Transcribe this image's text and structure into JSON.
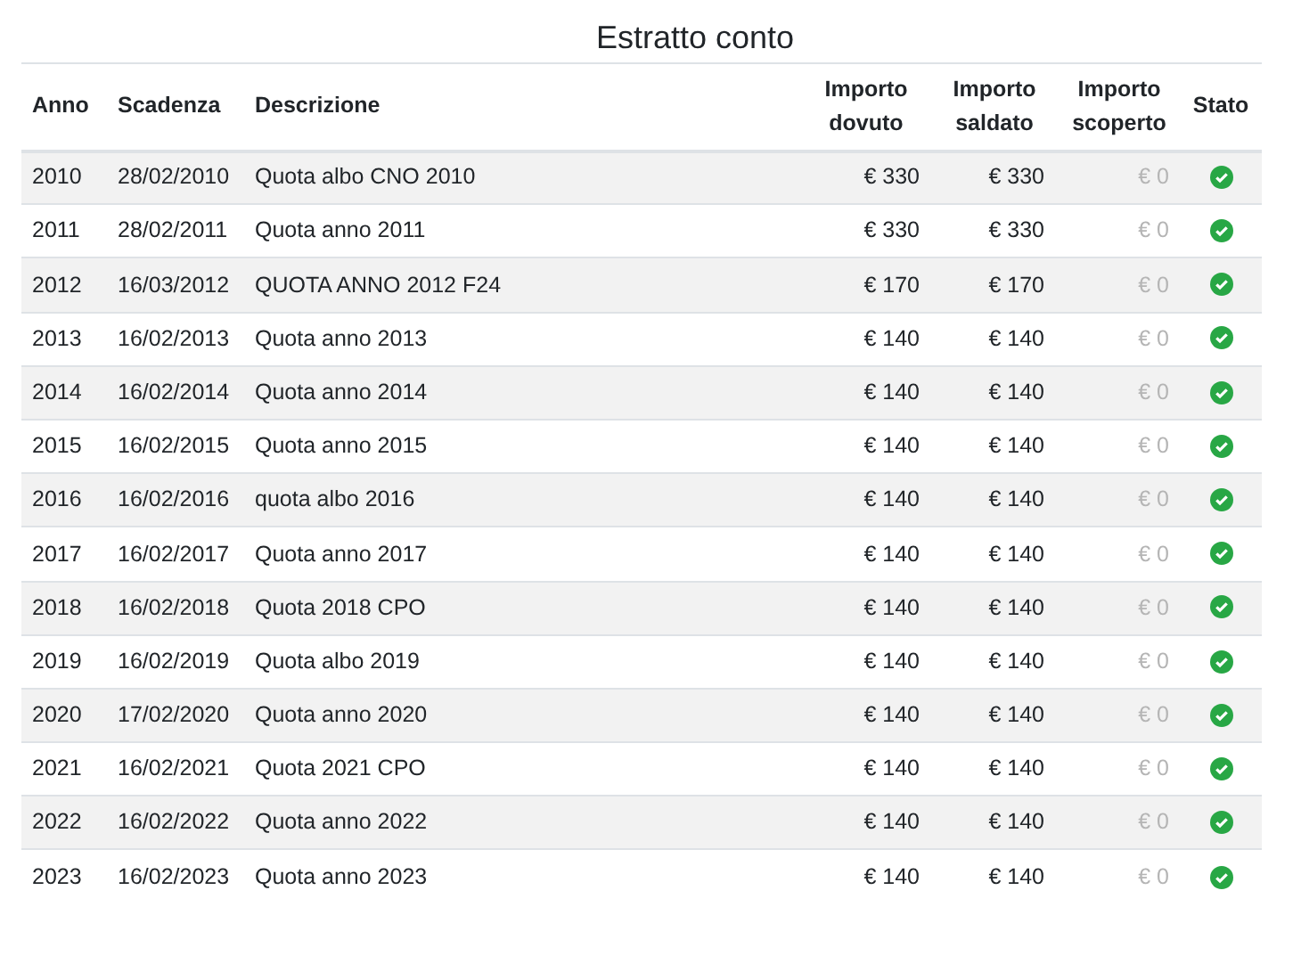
{
  "title": "Estratto conto",
  "columns": [
    "Anno",
    "Scadenza",
    "Descrizione",
    "Importo dovuto",
    "Importo saldato",
    "Importo scoperto",
    "Stato"
  ],
  "rows": [
    {
      "anno": "2010",
      "scadenza": "28/02/2010",
      "descrizione": "Quota albo CNO 2010",
      "dovuto": "€ 330",
      "saldato": "€ 330",
      "scoperto": "€ 0",
      "paid": true
    },
    {
      "anno": "2011",
      "scadenza": "28/02/2011",
      "descrizione": "Quota anno 2011",
      "dovuto": "€ 330",
      "saldato": "€ 330",
      "scoperto": "€ 0",
      "paid": true
    },
    {
      "anno": "2012",
      "scadenza": "16/03/2012",
      "descrizione": "QUOTA ANNO 2012 F24",
      "dovuto": "€ 170",
      "saldato": "€ 170",
      "scoperto": "€ 0",
      "paid": true
    },
    {
      "anno": "2013",
      "scadenza": "16/02/2013",
      "descrizione": "Quota anno 2013",
      "dovuto": "€ 140",
      "saldato": "€ 140",
      "scoperto": "€ 0",
      "paid": true
    },
    {
      "anno": "2014",
      "scadenza": "16/02/2014",
      "descrizione": "Quota anno 2014",
      "dovuto": "€ 140",
      "saldato": "€ 140",
      "scoperto": "€ 0",
      "paid": true
    },
    {
      "anno": "2015",
      "scadenza": "16/02/2015",
      "descrizione": "Quota anno 2015",
      "dovuto": "€ 140",
      "saldato": "€ 140",
      "scoperto": "€ 0",
      "paid": true
    },
    {
      "anno": "2016",
      "scadenza": "16/02/2016",
      "descrizione": "quota albo 2016",
      "dovuto": "€ 140",
      "saldato": "€ 140",
      "scoperto": "€ 0",
      "paid": true
    },
    {
      "anno": "2017",
      "scadenza": "16/02/2017",
      "descrizione": "Quota anno 2017",
      "dovuto": "€ 140",
      "saldato": "€ 140",
      "scoperto": "€ 0",
      "paid": true
    },
    {
      "anno": "2018",
      "scadenza": "16/02/2018",
      "descrizione": "Quota 2018 CPO",
      "dovuto": "€ 140",
      "saldato": "€ 140",
      "scoperto": "€ 0",
      "paid": true
    },
    {
      "anno": "2019",
      "scadenza": "16/02/2019",
      "descrizione": "Quota albo 2019",
      "dovuto": "€ 140",
      "saldato": "€ 140",
      "scoperto": "€ 0",
      "paid": true
    },
    {
      "anno": "2020",
      "scadenza": "17/02/2020",
      "descrizione": "Quota anno 2020",
      "dovuto": "€ 140",
      "saldato": "€ 140",
      "scoperto": "€ 0",
      "paid": true
    },
    {
      "anno": "2021",
      "scadenza": "16/02/2021",
      "descrizione": "Quota 2021 CPO",
      "dovuto": "€ 140",
      "saldato": "€ 140",
      "scoperto": "€ 0",
      "paid": true
    },
    {
      "anno": "2022",
      "scadenza": "16/02/2022",
      "descrizione": "Quota anno 2022",
      "dovuto": "€ 140",
      "saldato": "€ 140",
      "scoperto": "€ 0",
      "paid": true
    },
    {
      "anno": "2023",
      "scadenza": "16/02/2023",
      "descrizione": "Quota anno 2023",
      "dovuto": "€ 140",
      "saldato": "€ 140",
      "scoperto": "€ 0",
      "paid": true
    }
  ]
}
